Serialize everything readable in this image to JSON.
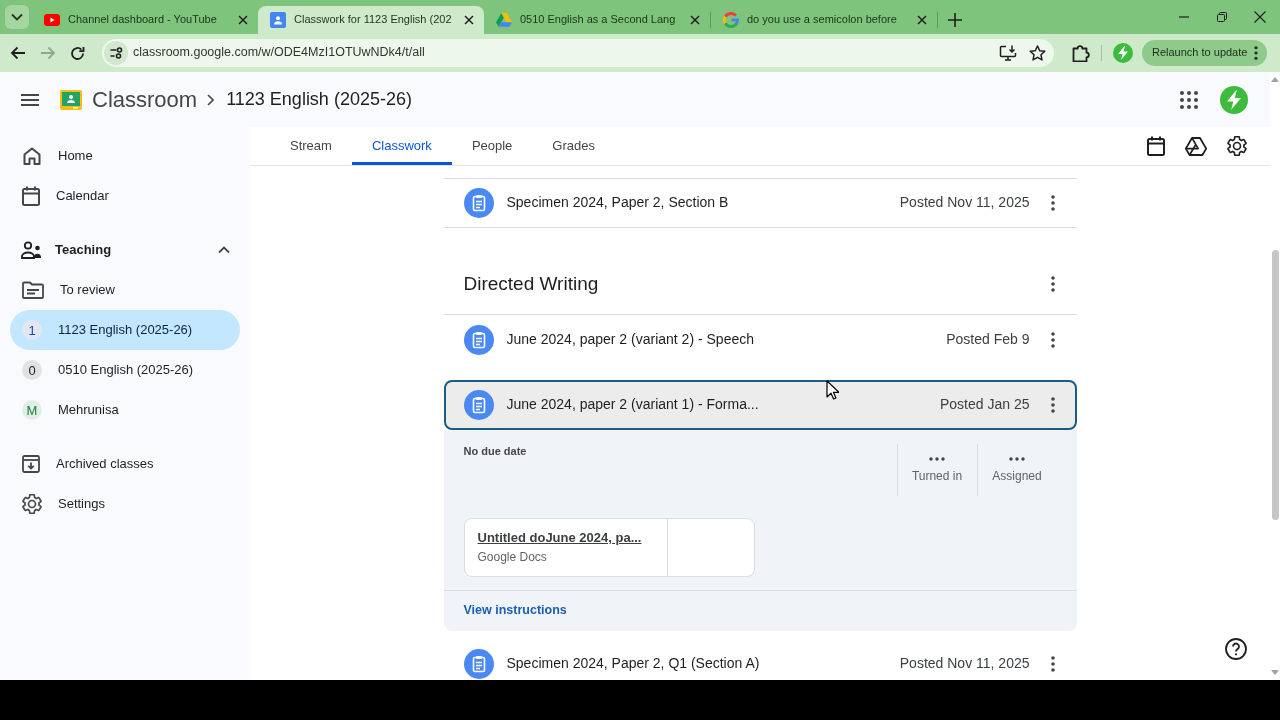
{
  "browser": {
    "tabs": [
      {
        "kind": "youtube",
        "title": "Channel dashboard - YouTube",
        "selected": false
      },
      {
        "kind": "classroom",
        "title": "Classwork for 1123 English (202",
        "selected": true
      },
      {
        "kind": "drive",
        "title": "0510 English as a Second Lang",
        "selected": false
      },
      {
        "kind": "google",
        "title": "do you use a semicolon before",
        "selected": false
      }
    ],
    "forward_disabled": true,
    "address": "classroom.google.com/w/ODE4MzI1OTUwNDk4/t/all",
    "relaunch_button": "Relaunch to update"
  },
  "header": {
    "app_name": "Classroom",
    "breadcrumb": "1123 English (2025-26)"
  },
  "sidebar": {
    "items": [
      {
        "kind": "home",
        "label": "Home",
        "selected": false
      },
      {
        "kind": "calendar",
        "label": "Calendar",
        "selected": false
      }
    ],
    "teaching": {
      "label": "Teaching",
      "expanded": true,
      "items": [
        {
          "kind": "review",
          "label": "To review",
          "selected": false
        },
        {
          "kind": "class",
          "initial": "1",
          "color": "#174ea6",
          "label": "1123 English (2025-26)",
          "selected": true
        },
        {
          "kind": "class",
          "initial": "0",
          "color": "#202124",
          "label": "0510 English (2025-26)",
          "selected": false
        },
        {
          "kind": "class",
          "initial": "M",
          "color": "#188038",
          "label": "Mehrunisa",
          "selected": false
        }
      ]
    },
    "bottom_items": [
      {
        "kind": "archive",
        "label": "Archived classes",
        "selected": false
      },
      {
        "kind": "settings",
        "label": "Settings",
        "selected": false
      }
    ]
  },
  "class_tabs": [
    {
      "label": "Stream",
      "selected": false
    },
    {
      "label": "Classwork",
      "selected": true
    },
    {
      "label": "People",
      "selected": false
    },
    {
      "label": "Grades",
      "selected": false
    }
  ],
  "classwork": [
    {
      "kind": "assignment",
      "title": "Specimen 2024, Paper 2, Section B",
      "posted": "Posted Nov 11, 2025",
      "expanded": false
    },
    {
      "kind": "topic",
      "title": "Directed Writing"
    },
    {
      "kind": "assignment",
      "title": "June 2024, paper 2 (variant 2) - Speech",
      "posted": "Posted Feb 9",
      "expanded": false
    },
    {
      "kind": "assignment",
      "title": "June 2024, paper 2 (variant 1) - Forma...",
      "posted": "Posted Jan 25",
      "expanded": true,
      "details": {
        "due": "No due date",
        "stats": [
          {
            "label": "Turned in"
          },
          {
            "label": "Assigned"
          }
        ],
        "attachment": {
          "title": "Untitled doJune 2024, pa...",
          "type": "Google Docs"
        },
        "link": "View instructions"
      }
    },
    {
      "kind": "assignment",
      "title": "Specimen 2024, Paper 2, Q1 (Section A)",
      "posted": "Posted Nov 11, 2025",
      "expanded": false
    }
  ]
}
